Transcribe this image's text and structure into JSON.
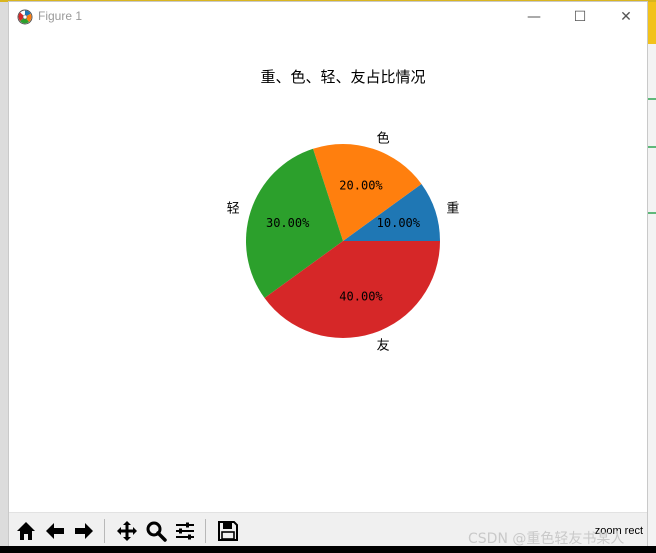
{
  "window": {
    "title": "Figure 1",
    "minimize_glyph": "—",
    "maximize_glyph": "☐",
    "close_glyph": "✕"
  },
  "toolbar": {
    "buttons": [
      {
        "name": "home-icon"
      },
      {
        "name": "back-arrow-icon"
      },
      {
        "name": "forward-arrow-icon"
      },
      {
        "name": "pan-icon"
      },
      {
        "name": "zoom-icon"
      },
      {
        "name": "subplots-icon"
      },
      {
        "name": "save-icon"
      }
    ],
    "mode_label": "zoom rect"
  },
  "watermark": "CSDN @重色轻友书某人",
  "chart_data": {
    "type": "pie",
    "title": "重、色、轻、友占比情况",
    "categories": [
      "重",
      "色",
      "轻",
      "友"
    ],
    "values": [
      10,
      20,
      30,
      40
    ],
    "labels": [
      "10.00%",
      "20.00%",
      "30.00%",
      "40.00%"
    ],
    "colors": [
      "#1f77b4",
      "#ff7f0e",
      "#2ca02c",
      "#d62728"
    ],
    "start_angle_deg": 0,
    "direction": "counterclockwise"
  }
}
